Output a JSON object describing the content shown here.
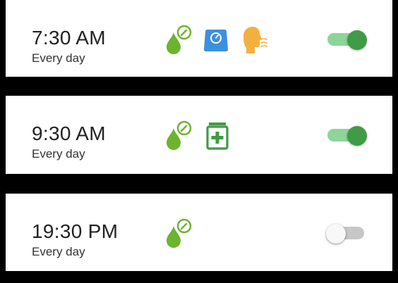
{
  "reminders": [
    {
      "time": "7:30 AM",
      "repeat": "Every day",
      "enabled": true,
      "icons": [
        "blood-glucose-icon",
        "weight-scale-icon",
        "breath-icon"
      ]
    },
    {
      "time": "9:30 AM",
      "repeat": "Every day",
      "enabled": true,
      "icons": [
        "blood-glucose-icon",
        "medication-icon"
      ]
    },
    {
      "time": "19:30 PM",
      "repeat": "Every day",
      "enabled": false,
      "icons": [
        "blood-glucose-icon"
      ]
    }
  ],
  "colors": {
    "glucose_green": "#6cb42e",
    "scale_blue": "#3d8fe0",
    "breath_orange": "#f4b03e",
    "medication_green": "#3f9b45",
    "toggle_on": "#3f9b45",
    "toggle_on_track": "#8ed59a",
    "toggle_off_track": "#c7c7c7"
  }
}
